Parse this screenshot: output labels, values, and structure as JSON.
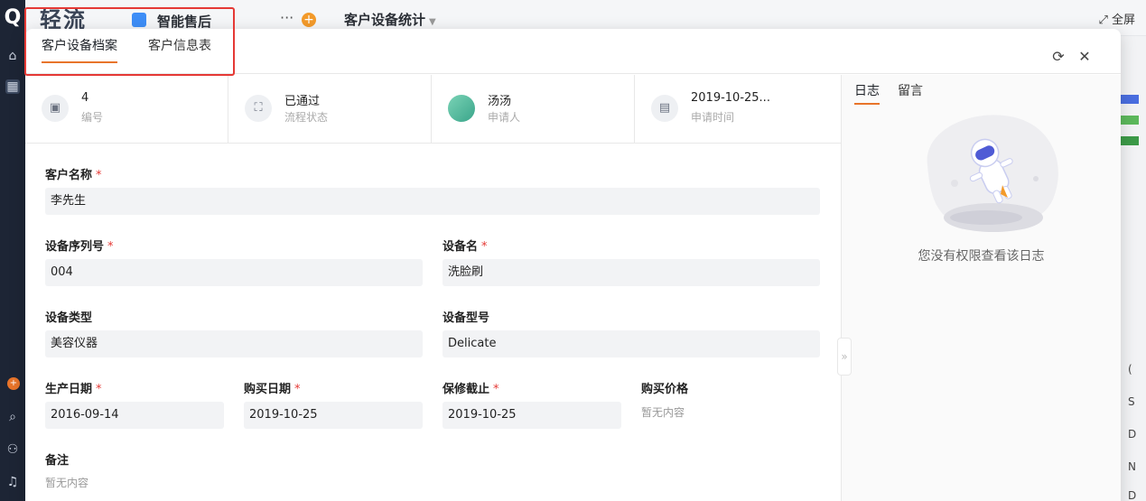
{
  "background": {
    "brand_text": "轻流",
    "app_name": "智能售后",
    "more": "···",
    "add": "+",
    "page_title": "客户设备统计",
    "fullscreen": "全屏",
    "right_labels": [
      "(",
      "S",
      "D",
      "N",
      "D"
    ]
  },
  "modal": {
    "tabs": [
      {
        "label": "客户设备档案",
        "active": true
      },
      {
        "label": "客户信息表",
        "active": false
      }
    ],
    "summary": [
      {
        "value": "4",
        "label": "编号",
        "icon": "id-card-icon"
      },
      {
        "value": "已通过",
        "label": "流程状态",
        "icon": "flow-icon"
      },
      {
        "value": "汤汤",
        "label": "申请人",
        "icon": "avatar"
      },
      {
        "value": "2019-10-25...",
        "label": "申请时间",
        "icon": "calendar-icon"
      }
    ],
    "fields": {
      "customer_name": {
        "label": "客户名称",
        "value": "李先生"
      },
      "serial_no": {
        "label": "设备序列号",
        "value": "004"
      },
      "device_name": {
        "label": "设备名",
        "value": "洗脸刷"
      },
      "device_type": {
        "label": "设备类型",
        "value": "美容仪器"
      },
      "device_model": {
        "label": "设备型号",
        "value": "Delicate"
      },
      "production_date": {
        "label": "生产日期",
        "value": "2016-09-14"
      },
      "purchase_date": {
        "label": "购买日期",
        "value": "2019-10-25"
      },
      "warranty_end": {
        "label": "保修截止",
        "value": "2019-10-25"
      },
      "purchase_price": {
        "label": "购买价格",
        "value": "暂无内容"
      },
      "remark": {
        "label": "备注",
        "value": "暂无内容"
      }
    },
    "required_mark": "*",
    "side": {
      "tabs": [
        {
          "label": "日志",
          "active": true
        },
        {
          "label": "留言",
          "active": false
        }
      ],
      "empty_message": "您没有权限查看该日志"
    },
    "collapse_glyph": "»"
  },
  "colors": {
    "accent": "#e8742a",
    "required": "#e53935",
    "highlight": "#e53935"
  }
}
